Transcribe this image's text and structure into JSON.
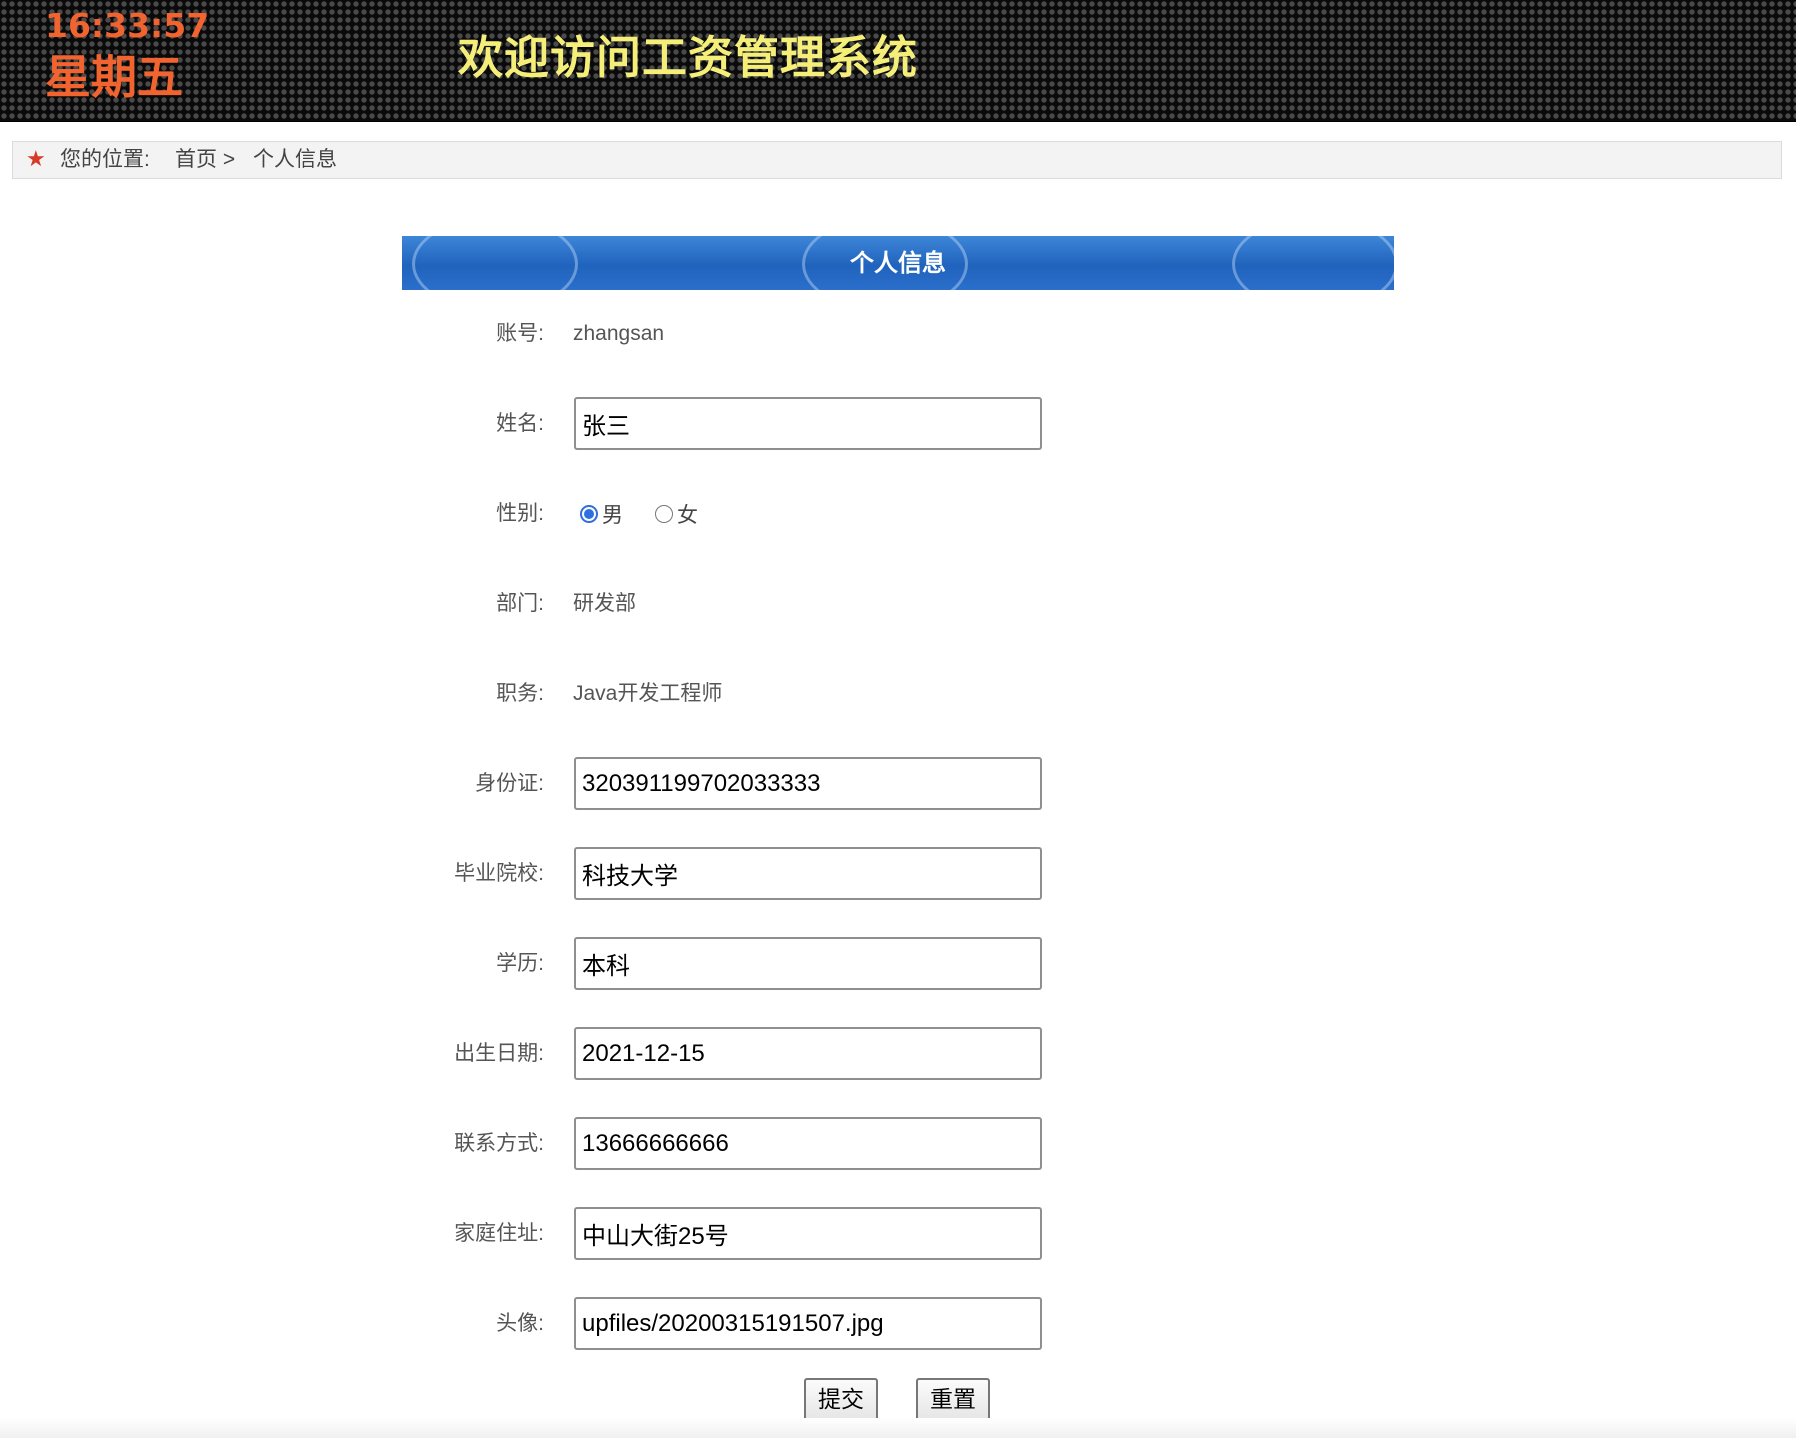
{
  "header": {
    "time": "16:33:57",
    "weekday": "星期五",
    "title": "欢迎访问工资管理系统"
  },
  "breadcrumb": {
    "prefix": "您的位置:",
    "home": "首页 >",
    "current": "个人信息",
    "icon": "star-icon"
  },
  "panel": {
    "title": "个人信息"
  },
  "form": {
    "account_label": "账号:",
    "account_value": "zhangsan",
    "name_label": "姓名:",
    "name_value": "张三",
    "gender_label": "性别:",
    "gender_options": [
      "男",
      "女"
    ],
    "gender_selected": "男",
    "dept_label": "部门:",
    "dept_value": "研发部",
    "job_label": "职务:",
    "job_value": "Java开发工程师",
    "id_label": "身份证:",
    "id_value": "320391199702033333",
    "school_label": "毕业院校:",
    "school_value": "科技大学",
    "edu_label": "学历:",
    "edu_value": "本科",
    "birth_label": "出生日期:",
    "birth_value": "2021-12-15",
    "phone_label": "联系方式:",
    "phone_value": "13666666666",
    "address_label": "家庭住址:",
    "address_value": "中山大街25号",
    "avatar_label": "头像:",
    "avatar_value": "upfiles/20200315191507.jpg"
  },
  "buttons": {
    "submit": "提交",
    "reset": "重置"
  },
  "colors": {
    "clock": "#f2642f",
    "title": "#f5ef7a",
    "panel_blue": "#2063bd",
    "star": "#d83a2a"
  }
}
